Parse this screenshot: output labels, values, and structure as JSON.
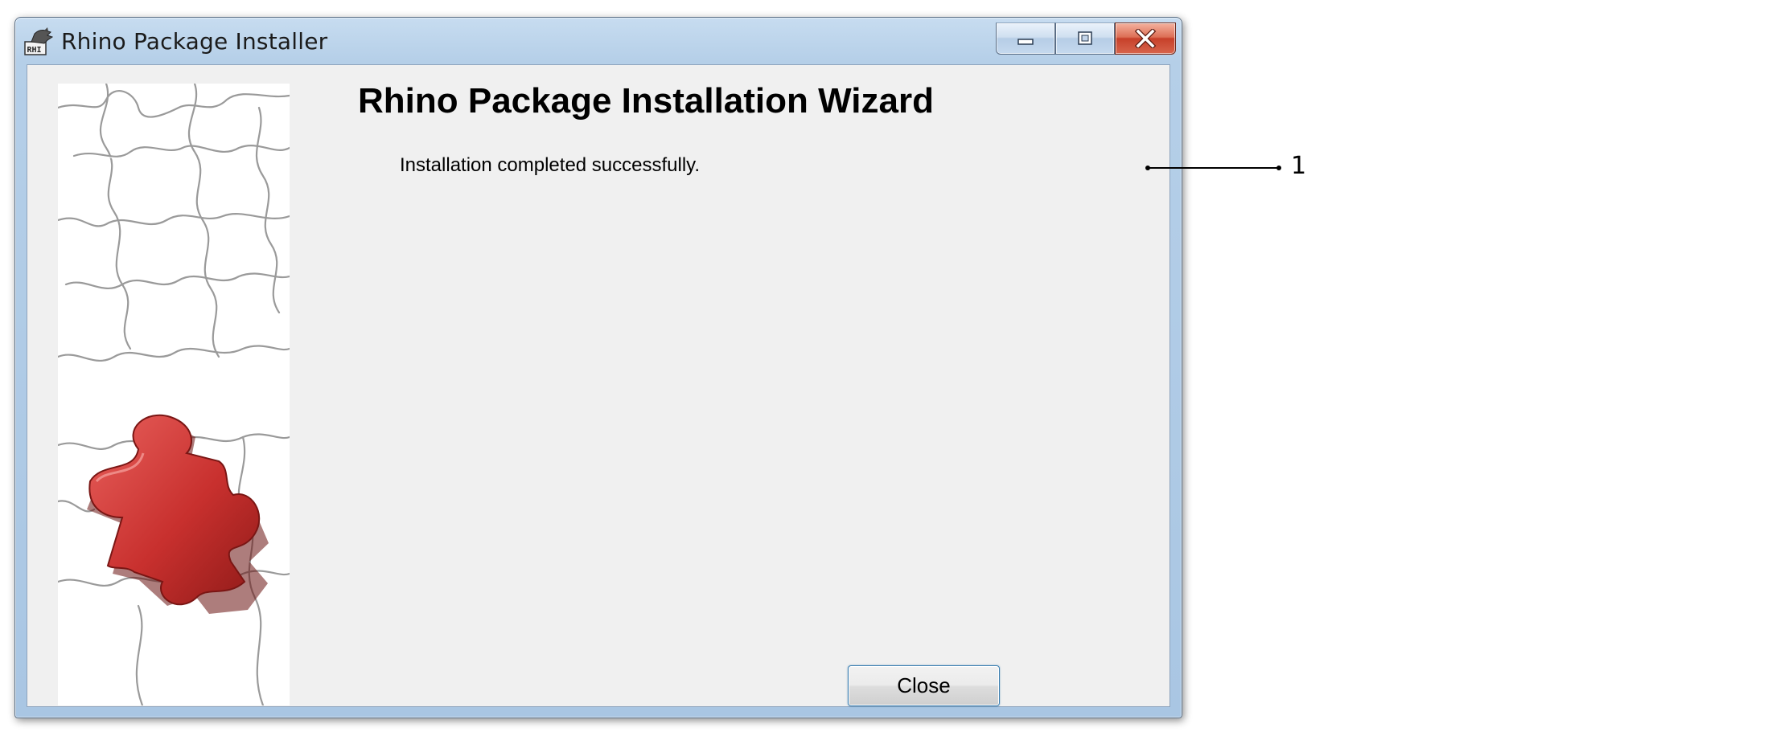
{
  "window": {
    "title": "Rhino Package Installer",
    "app_icon": "rhino-app-icon",
    "app_icon_text": "RHI"
  },
  "caption_buttons": {
    "minimize_icon": "minimize-icon",
    "maximize_icon": "maximize-icon",
    "close_icon": "close-icon"
  },
  "wizard": {
    "heading": "Rhino Package Installation Wizard",
    "status_message": "Installation completed successfully.",
    "close_label": "Close",
    "side_image": "puzzle-image"
  },
  "callout": {
    "label": "1"
  },
  "colors": {
    "client_background": "#f0f0f0",
    "puzzle_piece": "#c8302e",
    "button_focus_border": "#3c7fb1",
    "title_bar": "#b5cfe8"
  }
}
